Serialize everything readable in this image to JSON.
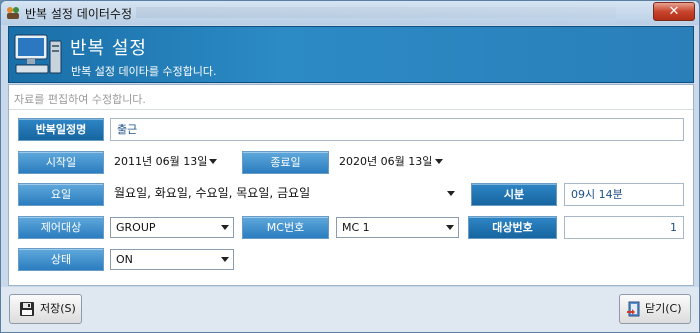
{
  "window": {
    "title": "반복 설정 데이터수정",
    "close_label": "✕"
  },
  "banner": {
    "title": "반복 설정",
    "subtitle": "반복 설정 데이타를 수정합니다."
  },
  "hint": "자료를 편집하여 수정합니다.",
  "form": {
    "name_label": "반복일정명",
    "name_value": "출근",
    "start_label": "시작일",
    "start_value": "2011년 06월 13일",
    "end_label": "종료일",
    "end_value": "2020년 06월 13일",
    "days_label": "요일",
    "days_value": "월요일, 화요일, 수요일, 목요일, 금요일",
    "time_label": "시분",
    "time_value": "09시 14분",
    "control_label": "제어대상",
    "control_value": "GROUP",
    "mc_label": "MC번호",
    "mc_value": "MC 1",
    "target_label": "대상번호",
    "target_value": "1",
    "status_label": "상태",
    "status_value": "ON"
  },
  "footer": {
    "save_label": "저장(S)",
    "close_label": "닫기(C)"
  },
  "colors": {
    "banner": "#2c8ac5",
    "label": "#2b7dbf",
    "label_dark": "#16659f",
    "close": "#c8442c"
  }
}
